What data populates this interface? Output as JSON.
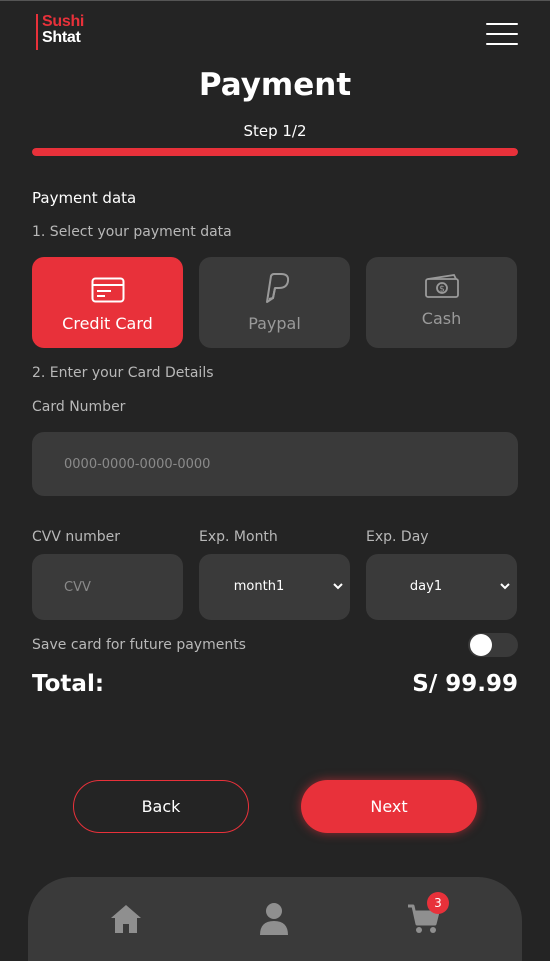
{
  "header": {
    "logo_line1": "Sushi",
    "logo_line2": "Shtat",
    "menu_icon": "hamburger-icon"
  },
  "page": {
    "title": "Payment",
    "step": "Step 1/2",
    "progress_percent": 100
  },
  "payment_data": {
    "section_title": "Payment data",
    "select_label": "1. Select your payment data",
    "methods": [
      {
        "label": "Credit Card",
        "icon": "credit-card-icon",
        "active": true
      },
      {
        "label": "Paypal",
        "icon": "paypal-icon",
        "active": false
      },
      {
        "label": "Cash",
        "icon": "cash-icon",
        "active": false
      }
    ]
  },
  "card_details": {
    "section_label": "2. Enter your Card Details",
    "card_number_label": "Card Number",
    "card_number_placeholder": "0000-0000-0000-0000",
    "card_number_value": "",
    "cvv_label": "CVV number",
    "cvv_placeholder": "CVV",
    "cvv_value": "",
    "exp_month_label": "Exp. Month",
    "exp_month_value": "month1",
    "exp_day_label": "Exp. Day",
    "exp_day_value": "day1",
    "save_card_label": "Save card for future payments",
    "save_card_enabled": false
  },
  "summary": {
    "total_label": "Total:",
    "total_value": "S/ 99.99"
  },
  "actions": {
    "back_label": "Back",
    "next_label": "Next"
  },
  "bottom_nav": {
    "items": [
      "home-icon",
      "user-icon",
      "cart-icon"
    ],
    "cart_count": "3"
  },
  "colors": {
    "accent": "#e8313a",
    "background": "#242424",
    "surface": "#3a3a3a"
  }
}
